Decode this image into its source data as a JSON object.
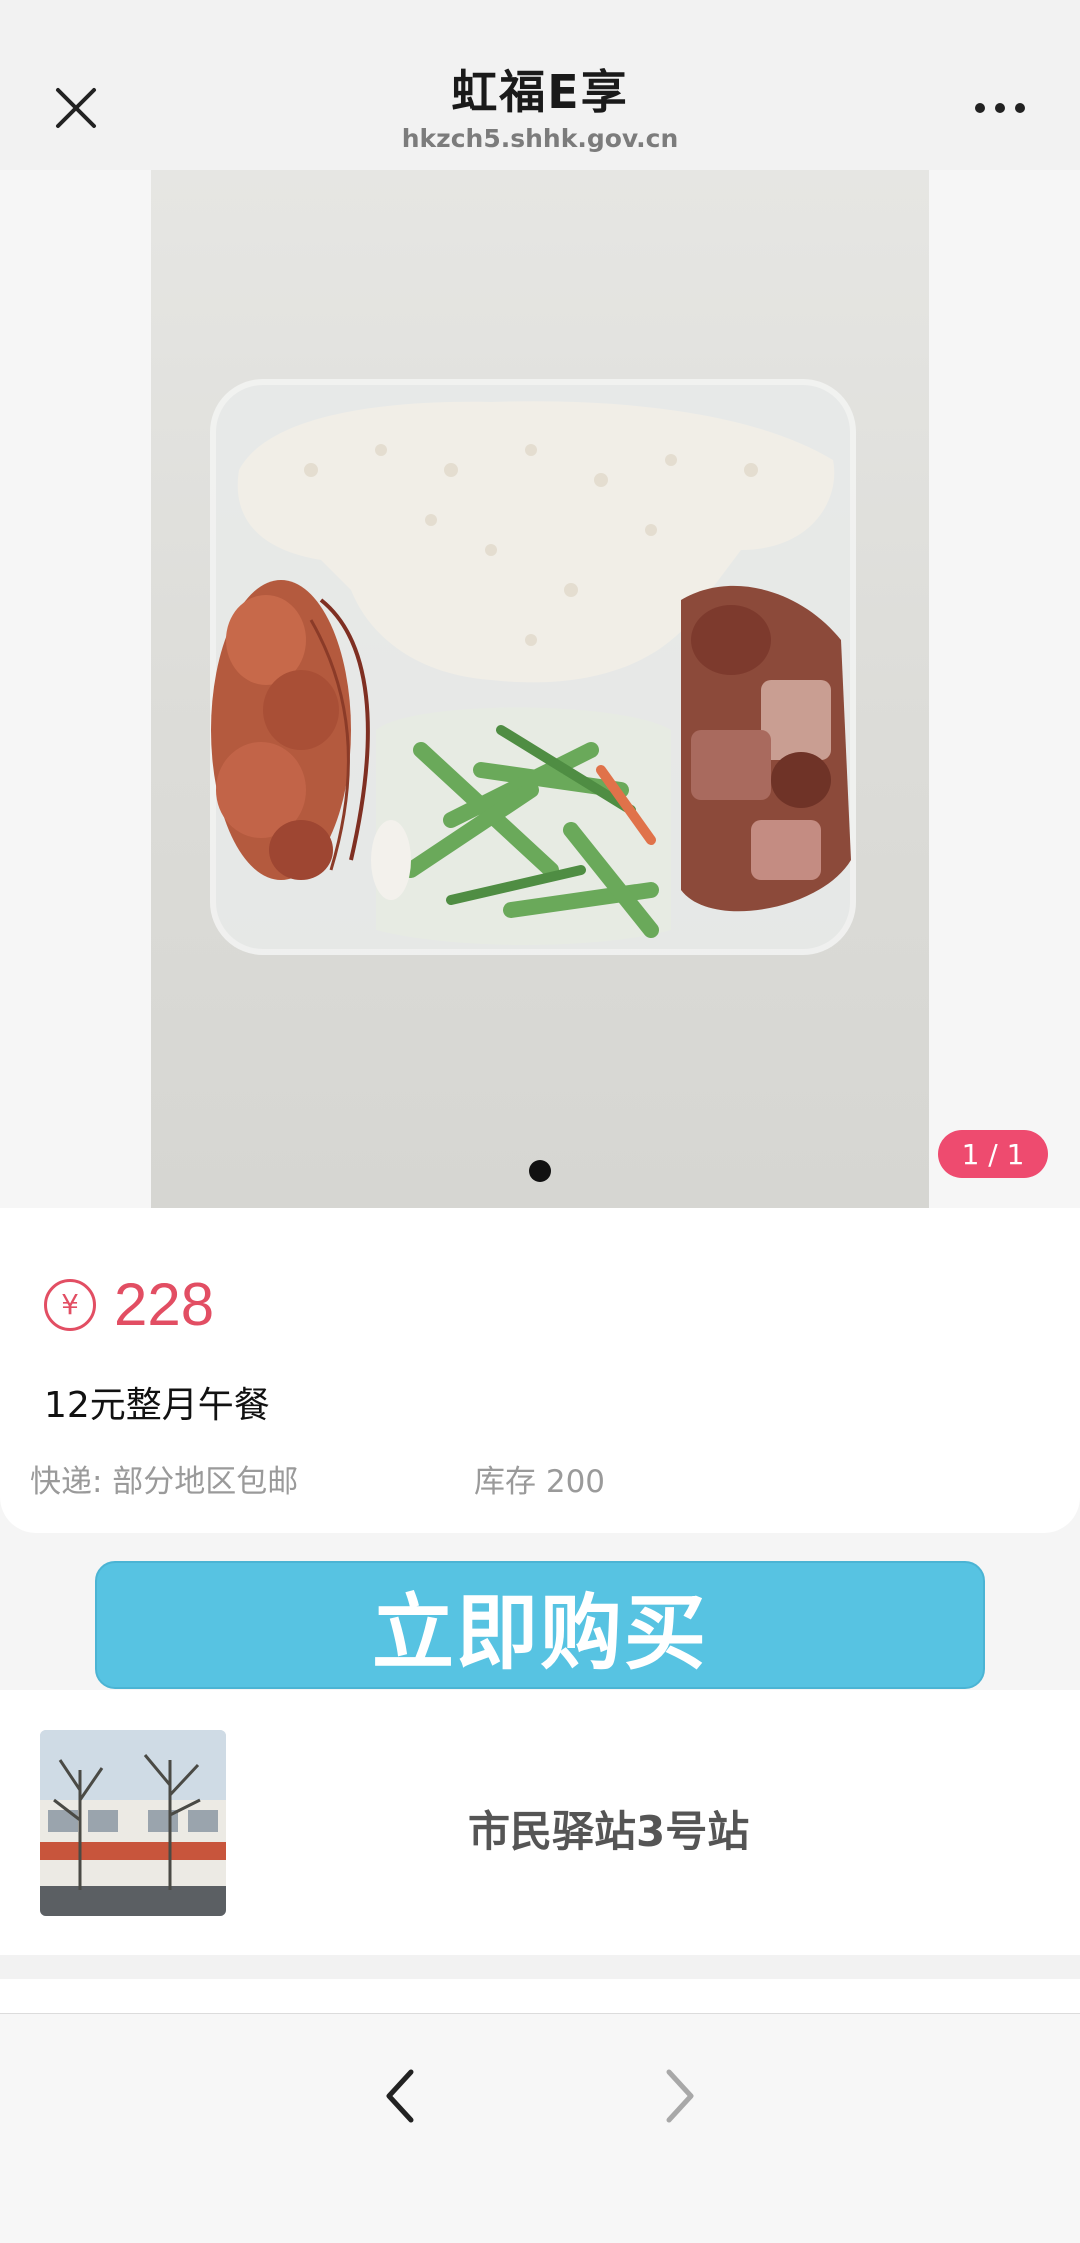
{
  "header": {
    "title": "虹福E享",
    "url": "hkzch5.shhk.gov.cn",
    "close_icon": "close-icon",
    "more_icon": "more-icon"
  },
  "gallery": {
    "counter": "1 / 1",
    "image": "boxed-lunch-photo"
  },
  "product": {
    "currency_symbol": "¥",
    "price": "228",
    "name": "12元整月午餐",
    "shipping": "快递: 部分地区包邮",
    "stock": "库存 200"
  },
  "actions": {
    "buy_label": "立即购买"
  },
  "store": {
    "name": "市民驿站3号站",
    "thumbnail": "store-photo"
  },
  "nav": {
    "back_icon": "chevron-left-icon",
    "forward_icon": "chevron-right-icon"
  },
  "colors": {
    "accent": "#e24e63",
    "counter_bg": "#ee4b6f",
    "buy_button": "#57c3e2"
  }
}
